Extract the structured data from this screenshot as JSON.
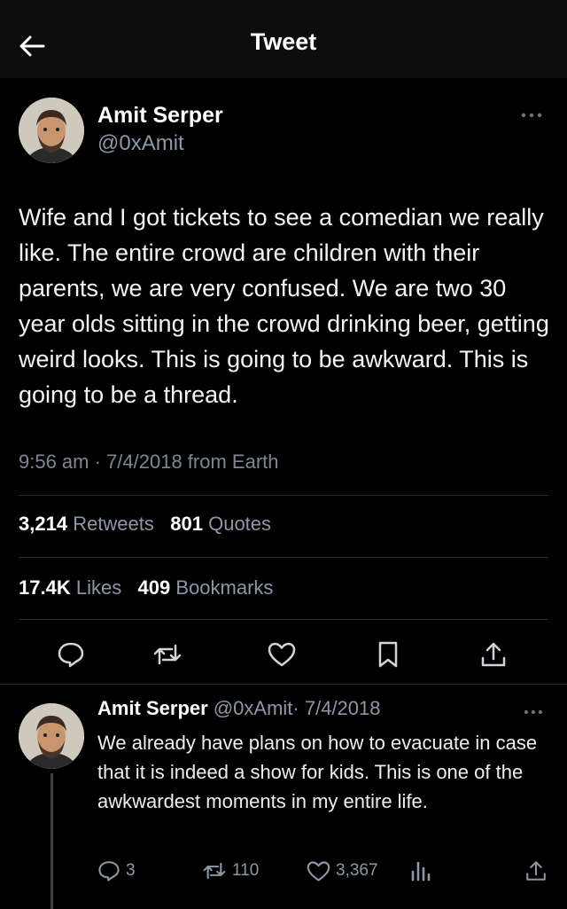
{
  "header": {
    "title": "Tweet",
    "back_icon": "arrow-left-icon"
  },
  "tweet": {
    "author_name": "Amit Serper",
    "author_handle": "@0xAmit",
    "text": "Wife and I got tickets to see a comedian we really like. The entire crowd are children with their parents, we are very confused. We are two 30 year olds sitting in the crowd drinking beer, getting weird looks. This is going to be awkward. This is going to be a thread.",
    "timestamp": "9:56 am · 7/4/2018 from Earth",
    "retweets_count": "3,214",
    "retweets_label": "Retweets",
    "quotes_count": "801",
    "quotes_label": "Quotes",
    "likes_count": "17.4K",
    "likes_label": "Likes",
    "bookmarks_count": "409",
    "bookmarks_label": "Bookmarks",
    "actions": [
      "reply-icon",
      "retweet-icon",
      "like-icon",
      "bookmark-icon",
      "share-icon"
    ]
  },
  "reply": {
    "author_name": "Amit Serper",
    "author_handle": "@0xAmit",
    "date": "· 7/4/2018",
    "text": "We already have plans on how to evacuate in case that it is indeed a show for kids. This is one of the awkwardest moments in my entire life.",
    "reply_count": "3",
    "retweet_count": "110",
    "like_count": "3,367"
  },
  "colors": {
    "background": "#000000",
    "text_primary": "#e7e9ea",
    "text_secondary": "#8b98a5",
    "divider": "#2b2f33"
  }
}
